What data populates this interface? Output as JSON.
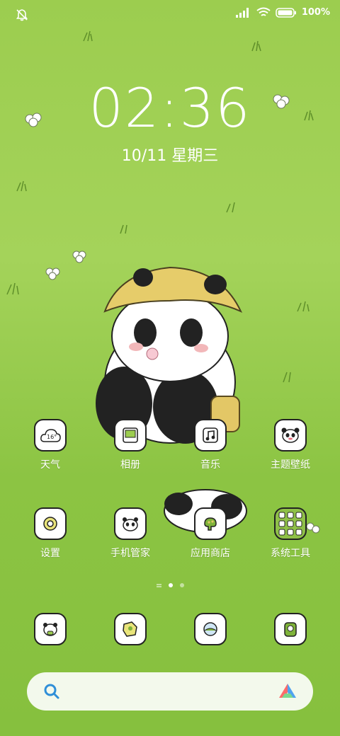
{
  "status_bar": {
    "battery_text": "100%",
    "icons": [
      "notification-muted-icon",
      "signal-icon",
      "wifi-icon",
      "battery-icon"
    ]
  },
  "lockscreen": {
    "time": "02:36",
    "date": "10/11 星期三"
  },
  "apps_row1": [
    {
      "label": "天气",
      "icon": "weather-icon",
      "badge": "16°"
    },
    {
      "label": "相册",
      "icon": "gallery-icon"
    },
    {
      "label": "音乐",
      "icon": "music-icon"
    },
    {
      "label": "主题壁纸",
      "icon": "theme-icon"
    }
  ],
  "apps_row2": [
    {
      "label": "设置",
      "icon": "settings-icon"
    },
    {
      "label": "手机管家",
      "icon": "phone-manager-icon"
    },
    {
      "label": "应用商店",
      "icon": "app-store-icon"
    },
    {
      "label": "系统工具",
      "icon": "system-tools-folder-icon"
    }
  ],
  "page_indicator": {
    "pages": 2,
    "current": 1
  },
  "dock": [
    {
      "icon": "phone-icon"
    },
    {
      "icon": "messages-icon"
    },
    {
      "icon": "browser-icon"
    },
    {
      "icon": "camera-icon"
    }
  ],
  "search": {
    "icon": "search-icon",
    "assistant_icon": "assistant-icon"
  },
  "colors": {
    "background": "#9ccd4f",
    "accent": "#2f8fd8"
  }
}
